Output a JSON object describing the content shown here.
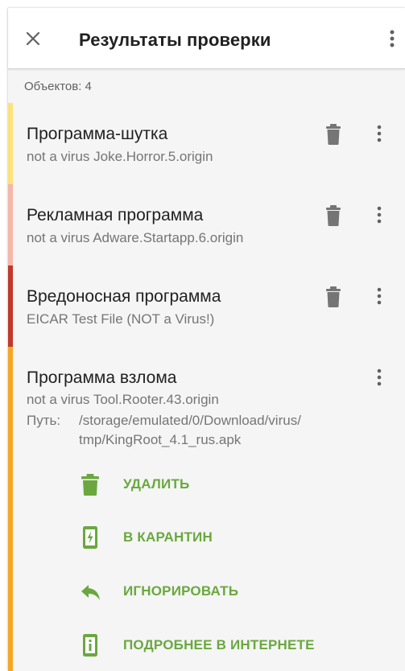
{
  "header": {
    "title": "Результаты проверки"
  },
  "summary": {
    "objects_label": "Объектов: 4"
  },
  "threats": [
    {
      "title": "Программа-шутка",
      "detail": "not a virus Joke.Horror.5.origin",
      "color": "#fde27a"
    },
    {
      "title": "Рекламная программа",
      "detail": "not a virus Adware.Startapp.6.origin",
      "color": "#f6b6a8"
    },
    {
      "title": "Вредоносная программа",
      "detail": "EICAR Test File (NOT a Virus!)",
      "color": "#c0392b"
    },
    {
      "title": "Программа взлома",
      "detail": "not a virus Tool.Rooter.43.origin",
      "color": "#f5a623",
      "path_label": "Путь:",
      "path_line1": "/storage/emulated/0/Download/virus/",
      "path_line2": "tmp/KingRoot_4.1_rus.apk",
      "actions": [
        {
          "label": "УДАЛИТЬ",
          "icon": "trash-icon"
        },
        {
          "label": "В КАРАНТИН",
          "icon": "quarantine-icon"
        },
        {
          "label": "ИГНОРИРОВАТЬ",
          "icon": "reply-icon"
        },
        {
          "label": "ПОДРОБНЕЕ В ИНТЕРНЕТЕ",
          "icon": "info-phone-icon"
        }
      ]
    }
  ],
  "colors": {
    "accent_green": "#6aa83f",
    "icon_gray": "#757575"
  }
}
